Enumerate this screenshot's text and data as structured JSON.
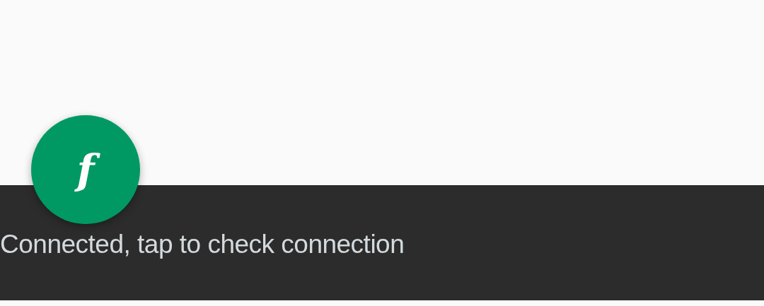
{
  "fab": {
    "label": "f"
  },
  "snackbar": {
    "message": "Connected, tap to check connection"
  }
}
